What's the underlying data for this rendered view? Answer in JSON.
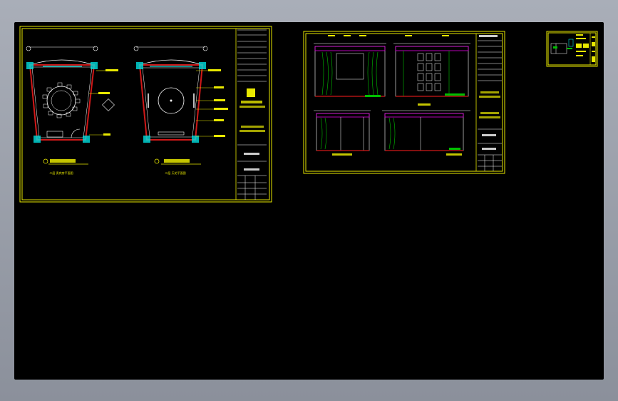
{
  "viewport": {
    "background": "#000000",
    "frame_color": "#e8e800"
  },
  "sheets": [
    {
      "id": "sheet-1",
      "drawings": [
        {
          "name": "plan-left",
          "caption": "二层 贵宾房平面图"
        },
        {
          "name": "plan-right",
          "caption": "二层 天花平面图"
        }
      ]
    },
    {
      "id": "sheet-2",
      "drawings": [
        {
          "name": "elevation-a"
        },
        {
          "name": "elevation-b"
        },
        {
          "name": "elevation-c"
        },
        {
          "name": "elevation-d"
        }
      ]
    },
    {
      "id": "sheet-3",
      "drawings": []
    }
  ],
  "colors": {
    "yellow": "#e8e800",
    "cyan": "#00e0e0",
    "red": "#d01818",
    "white": "#ffffff",
    "magenta": "#e000e0",
    "green": "#00c000"
  }
}
